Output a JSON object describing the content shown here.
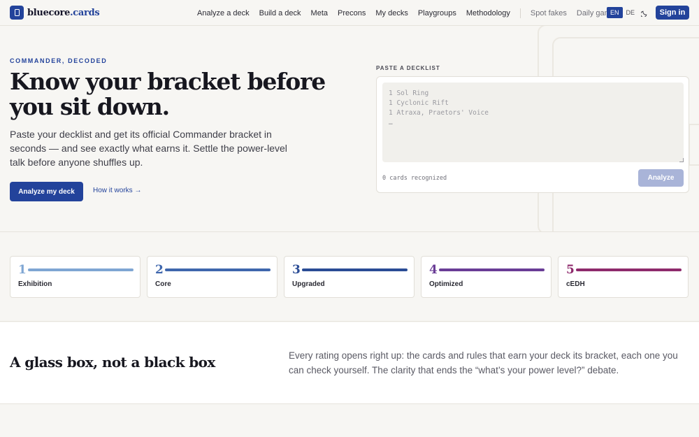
{
  "brand": {
    "name_main": "bluecore",
    "name_accent": ".cards",
    "logo_icon": "card-logo-icon"
  },
  "nav": {
    "links": [
      "Analyze a deck",
      "Build a deck",
      "Meta",
      "Precons",
      "My decks",
      "Playgroups",
      "Methodology"
    ],
    "secondary": [
      "Spot fakes",
      "Daily game"
    ],
    "lang_active": "EN",
    "lang_other": "DE",
    "theme_icon": "moon-icon",
    "signin": "Sign in"
  },
  "hero": {
    "eyebrow": "COMMANDER, DECODED",
    "headline": "Know your bracket before you sit down.",
    "lede": "Paste your decklist and get its official Commander bracket in seconds — and see exactly what earns it. Settle the power-level talk before anyone shuffles up.",
    "cta_primary": "Analyze my deck",
    "cta_link": "How it works →"
  },
  "paste": {
    "label": "PASTE A DECKLIST",
    "placeholder": "1 Sol Ring\n1 Cyclonic Rift\n1 Atraxa, Praetors' Voice\n…",
    "count_text": "0 cards recognized",
    "analyze": "Analyze"
  },
  "brackets": [
    {
      "num": "1",
      "name": "Exhibition",
      "color": "#7fa6d3",
      "num_color": "#7fa6d3"
    },
    {
      "num": "2",
      "name": "Core",
      "color": "#3f67ad",
      "num_color": "#3f67ad"
    },
    {
      "num": "3",
      "name": "Upgraded",
      "color": "#2a4c95",
      "num_color": "#2a4c95"
    },
    {
      "num": "4",
      "name": "Optimized",
      "color": "#6a3d96",
      "num_color": "#6a3d96"
    },
    {
      "num": "5",
      "name": "cEDH",
      "color": "#8e2a6c",
      "num_color": "#8e2a6c"
    }
  ],
  "glass": {
    "title": "A glass box, not a black box",
    "body": "Every rating opens right up: the cards and rules that earn your deck its bracket, each one you can check yourself. The clarity that ends the “what’s your power level?” debate."
  },
  "colors": {
    "accent": "#23439b",
    "background": "#f7f6f3"
  }
}
